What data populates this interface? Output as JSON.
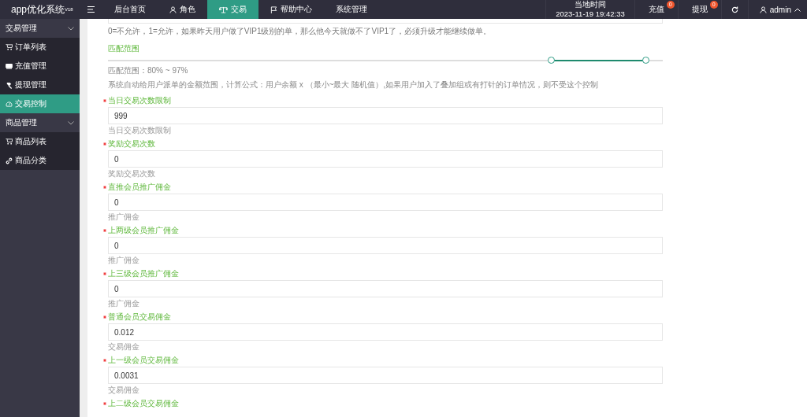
{
  "brand": "app优化系统$^{V18}$",
  "top_nav": [
    {
      "label": "后台首页",
      "selected": false
    },
    {
      "label": "角色",
      "selected": false
    },
    {
      "label": "交易",
      "selected": true
    },
    {
      "label": "帮助中心",
      "selected": false
    },
    {
      "label": "系统管理",
      "selected": false
    }
  ],
  "clock": {
    "label": "当地时间",
    "value": "2023-11-19 19:42:33"
  },
  "actions": [
    {
      "label": "充值",
      "badge": "0"
    },
    {
      "label": "提现",
      "badge": "0"
    }
  ],
  "user": {
    "name": "admin",
    "expanded": true
  },
  "sidebar": {
    "groups": [
      {
        "label": "交易管理",
        "expanded": true,
        "children": [
          {
            "label": "订单列表",
            "selected": false
          },
          {
            "label": "充值管理",
            "selected": false
          },
          {
            "label": "提现管理",
            "selected": false
          },
          {
            "label": "交易控制",
            "selected": true
          }
        ]
      },
      {
        "label": "商品管理",
        "expanded": true,
        "children": [
          {
            "label": "商品列表",
            "selected": false
          },
          {
            "label": "商品分类",
            "selected": false
          }
        ]
      }
    ]
  },
  "form": {
    "top_hint": "0=不允许，1=允许，如果昨天用户做了VIP1级别的单，那么他今天就做不了VIP1了，必须升级才能继续做单。",
    "range": {
      "label": "匹配范围",
      "handles": [
        {
          "level": 0.8
        },
        {
          "level": 0.97
        }
      ],
      "reading": "匹配范围：80% ~ 97%",
      "description": "系统自动给用户派单的金额范围，计算公式：用户余额 x （最小~最大 随机值）,如果用户加入了叠加组或有打针的订单情况，则不受这个控制"
    },
    "fields": [
      {
        "label": "当日交易次数限制",
        "required": true,
        "value": "999",
        "help": "当日交易次数限制"
      },
      {
        "label": "奖励交易次数",
        "required": true,
        "value": "0",
        "help": "奖励交易次数"
      },
      {
        "label": "直推会员推广佣金",
        "required": true,
        "value": "0",
        "help": "推广佣金"
      },
      {
        "label": "上两级会员推广佣金",
        "required": true,
        "value": "0",
        "help": "推广佣金"
      },
      {
        "label": "上三级会员推广佣金",
        "required": true,
        "value": "0",
        "help": "推广佣金"
      },
      {
        "label": "普通会员交易佣金",
        "required": true,
        "value": "0.012",
        "help": "交易佣金"
      },
      {
        "label": "上一级会员交易佣金",
        "required": true,
        "value": "0.0031",
        "help": "交易佣金"
      },
      {
        "label": "上二级会员交易佣金",
        "required": true
      }
    ]
  }
}
